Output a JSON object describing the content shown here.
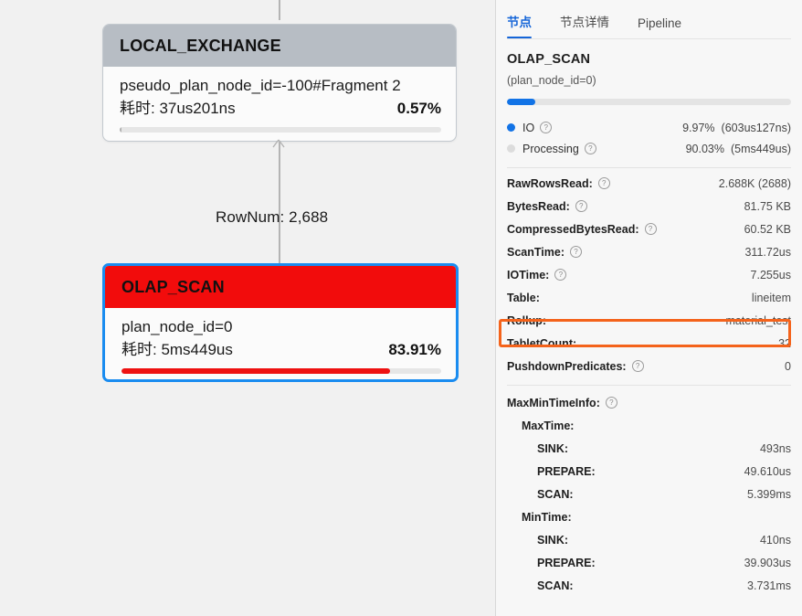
{
  "graph": {
    "edge_label": "RowNum: 2,688",
    "nodes": [
      {
        "title": "LOCAL_EXCHANGE",
        "detail": "pseudo_plan_node_id=-100#Fragment 2",
        "cost": "耗时: 37us201ns",
        "percent_label": "0.57%",
        "percent_value": 0.57,
        "header_color": "#b7bdc4",
        "bar_color": "#b0b0b0"
      },
      {
        "title": "OLAP_SCAN",
        "detail": "plan_node_id=0",
        "cost": "耗时: 5ms449us",
        "percent_label": "83.91%",
        "percent_value": 83.91,
        "header_color": "#f20c0c",
        "bar_color": "#ee1111",
        "selected_border_color": "#1a8cf0"
      }
    ]
  },
  "panel": {
    "tabs": [
      {
        "label": "节点",
        "active": true
      },
      {
        "label": "节点详情",
        "active": false
      },
      {
        "label": "Pipeline",
        "active": false
      }
    ],
    "node_name": "OLAP_SCAN",
    "node_sub": "(plan_node_id=0)",
    "ratio_bar": {
      "fill_percent": 9.97,
      "fill_color": "#1273e6",
      "track_color": "#e4e4e4"
    },
    "legend": [
      {
        "name": "IO",
        "dot_color": "#1273e6",
        "percent": "9.97%",
        "value": "(603us127ns)",
        "has_help_icon": true
      },
      {
        "name": "Processing",
        "dot_color": "#dcdcdc",
        "percent": "90.03%",
        "value": "(5ms449us)",
        "has_help_icon": true
      }
    ],
    "metrics_group_1": [
      {
        "key": "RawRowsRead:",
        "value": "2.688K (2688)",
        "help": true,
        "indent": 0
      },
      {
        "key": "BytesRead:",
        "value": "81.75 KB",
        "help": true,
        "indent": 0
      },
      {
        "key": "CompressedBytesRead:",
        "value": "60.52 KB",
        "help": true,
        "indent": 0
      },
      {
        "key": "ScanTime:",
        "value": "311.72us",
        "help": true,
        "indent": 0
      },
      {
        "key": "IOTime:",
        "value": "7.255us",
        "help": true,
        "indent": 0
      },
      {
        "key": "Table:",
        "value": "lineitem",
        "help": false,
        "indent": 0
      },
      {
        "key": "Rollup:",
        "value": "material_test",
        "help": false,
        "indent": 0,
        "highlighted": true
      },
      {
        "key": "TabletCount:",
        "value": "32",
        "help": false,
        "indent": 0
      },
      {
        "key": "PushdownPredicates:",
        "value": "0",
        "help": true,
        "indent": 0
      }
    ],
    "metrics_group_2": [
      {
        "key": "MaxMinTimeInfo:",
        "value": "",
        "help": true,
        "indent": 0
      },
      {
        "key": "MaxTime:",
        "value": "",
        "help": false,
        "indent": 1
      },
      {
        "key": "SINK:",
        "value": "493ns",
        "help": false,
        "indent": 2
      },
      {
        "key": "PREPARE:",
        "value": "49.610us",
        "help": false,
        "indent": 2
      },
      {
        "key": "SCAN:",
        "value": "5.399ms",
        "help": false,
        "indent": 2
      },
      {
        "key": "MinTime:",
        "value": "",
        "help": false,
        "indent": 1
      },
      {
        "key": "SINK:",
        "value": "410ns",
        "help": false,
        "indent": 2
      },
      {
        "key": "PREPARE:",
        "value": "39.903us",
        "help": false,
        "indent": 2
      },
      {
        "key": "SCAN:",
        "value": "3.731ms",
        "help": false,
        "indent": 2
      }
    ]
  },
  "annotation": {
    "target": "Rollup:",
    "color": "#f4631b"
  }
}
